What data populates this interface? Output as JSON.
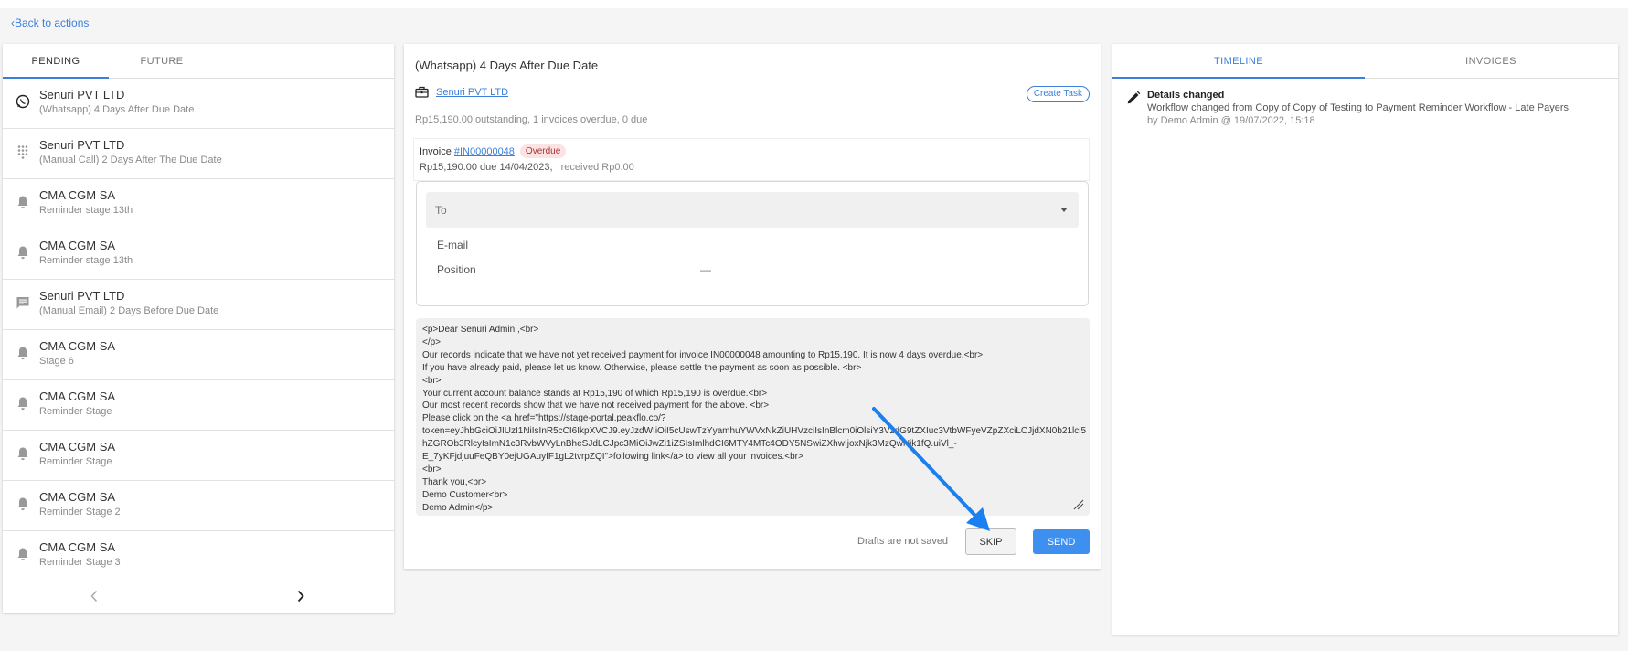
{
  "nav": {
    "back_label": "Back to actions"
  },
  "left_panel": {
    "tabs": [
      {
        "label": "PENDING",
        "active": true
      },
      {
        "label": "FUTURE",
        "active": false
      }
    ],
    "items": [
      {
        "name": "Senuri PVT LTD",
        "sub": "(Whatsapp) 4 Days After Due Date",
        "icon": "whatsapp-icon"
      },
      {
        "name": "Senuri PVT LTD",
        "sub": "(Manual Call) 2 Days After The Due Date",
        "icon": "dialpad-icon"
      },
      {
        "name": "CMA CGM SA",
        "sub": "Reminder stage 13th",
        "icon": "bell-icon"
      },
      {
        "name": "CMA CGM SA",
        "sub": "Reminder stage 13th",
        "icon": "bell-icon"
      },
      {
        "name": "Senuri PVT LTD",
        "sub": "(Manual Email) 2 Days Before Due Date",
        "icon": "message-icon"
      },
      {
        "name": "CMA CGM SA",
        "sub": "Stage 6",
        "icon": "bell-icon"
      },
      {
        "name": "CMA CGM SA",
        "sub": "Reminder Stage",
        "icon": "bell-icon"
      },
      {
        "name": "CMA CGM SA",
        "sub": "Reminder Stage",
        "icon": "bell-icon"
      },
      {
        "name": "CMA CGM SA",
        "sub": "Reminder Stage 2",
        "icon": "bell-icon"
      },
      {
        "name": "CMA CGM SA",
        "sub": "Reminder Stage 3",
        "icon": "bell-icon"
      }
    ]
  },
  "action": {
    "title": "(Whatsapp) 4 Days After Due Date",
    "customer": "Senuri PVT LTD",
    "create_task_label": "Create Task",
    "summary": "Rp15,190.00 outstanding, 1 invoices overdue, 0 due",
    "invoice": {
      "prefix": "Invoice",
      "number": "#IN00000048",
      "status": "Overdue",
      "due_text": "Rp15,190.00 due 14/04/2023,",
      "received_text": "received Rp0.00"
    },
    "recipient": {
      "to_label": "To",
      "email_label": "E-mail",
      "position_label": "Position",
      "position_value": "—"
    },
    "message_lines": [
      "<p>Dear Senuri Admin ,<br>",
      "</p>",
      "Our records indicate that we have not yet received payment for invoice IN00000048 amounting to Rp15,190. It is now 4 days overdue.<br>",
      "If you have already paid, please let us know. Otherwise, please settle the payment as soon as possible. <br>",
      "<br>",
      "Your current account balance stands at Rp15,190 of which Rp15,190 is overdue.<br>",
      "Our most recent records show that we have not received payment for the above. <br>",
      "Please click on the <a href=\"https://stage-portal.peakflo.co/?",
      "token=eyJhbGciOiJIUzI1NiIsInR5cCI6IkpXVCJ9.eyJzdWIiOiI5cUswTzYyamhuYWVxNkZiUHVzciIsInBlcm0iOlsiY3VzdG9tZXIuc3VtbWFyeVZpZXciLCJjdXN0b21lci5",
      "hZGROb3RlcyIsImN1c3RvbWVyLnBheSJdLCJpc3MiOiJwZi1iZSIsImlhdCI6MTY4MTc4ODY5NSwiZXhwIjoxNjk3MzQwNjk1fQ.uiVl_-",
      "E_7yKFjdjuuFeQBY0ejUGAuyfF1gL2tvrpZQI\">following link</a> to view all your invoices.<br>",
      "<br>",
      "Thank you,<br>",
      "Demo Customer<br>",
      "Demo Admin</p>"
    ],
    "footer": {
      "note": "Drafts are not saved",
      "skip_label": "SKIP",
      "send_label": "SEND"
    }
  },
  "right_panel": {
    "tabs": [
      {
        "label": "TIMELINE",
        "active": true
      },
      {
        "label": "INVOICES",
        "active": false
      }
    ],
    "timeline": [
      {
        "icon": "pencil-icon",
        "title": "Details changed",
        "description": "Workflow changed from Copy of Copy of Testing to Payment Reminder Workflow - Late Payers",
        "meta": "by Demo Admin @ 19/07/2022, 15:18"
      }
    ]
  },
  "colors": {
    "accent": "#3d7fd8",
    "send_button": "#3d8ff0",
    "annotation_arrow": "#1a7ff0",
    "overdue_badge_bg": "#fbe3e3"
  }
}
